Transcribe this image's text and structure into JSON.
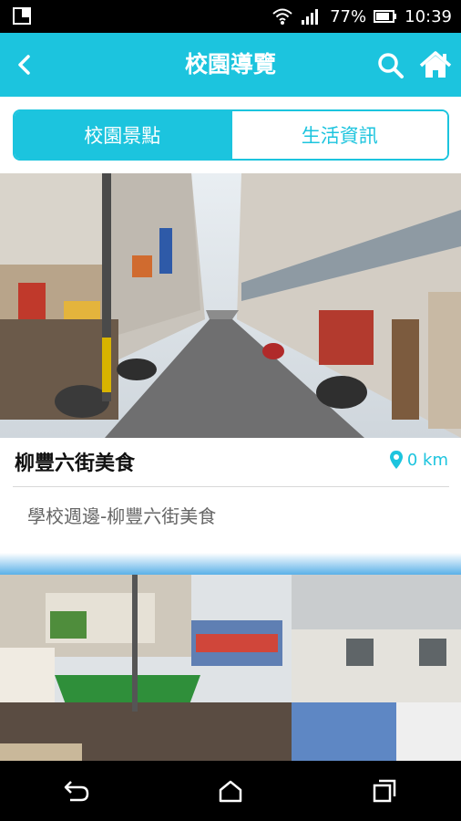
{
  "status_bar": {
    "battery": "77%",
    "time": "10:39"
  },
  "app_bar": {
    "title": "校園導覽"
  },
  "tabs": [
    {
      "label": "校園景點",
      "active": true
    },
    {
      "label": "生活資訊",
      "active": false
    }
  ],
  "cards": [
    {
      "title": "柳豐六街美食",
      "distance": "0 km",
      "description": "學校週邊-柳豐六街美食"
    }
  ],
  "colors": {
    "accent": "#1cc4de",
    "status_bar": "#000000"
  },
  "icons": [
    "back-arrow-icon",
    "search-icon",
    "home-icon",
    "location-pin-icon",
    "wifi-icon",
    "signal-icon",
    "battery-icon",
    "nav-back-icon",
    "nav-home-icon",
    "nav-recents-icon"
  ]
}
